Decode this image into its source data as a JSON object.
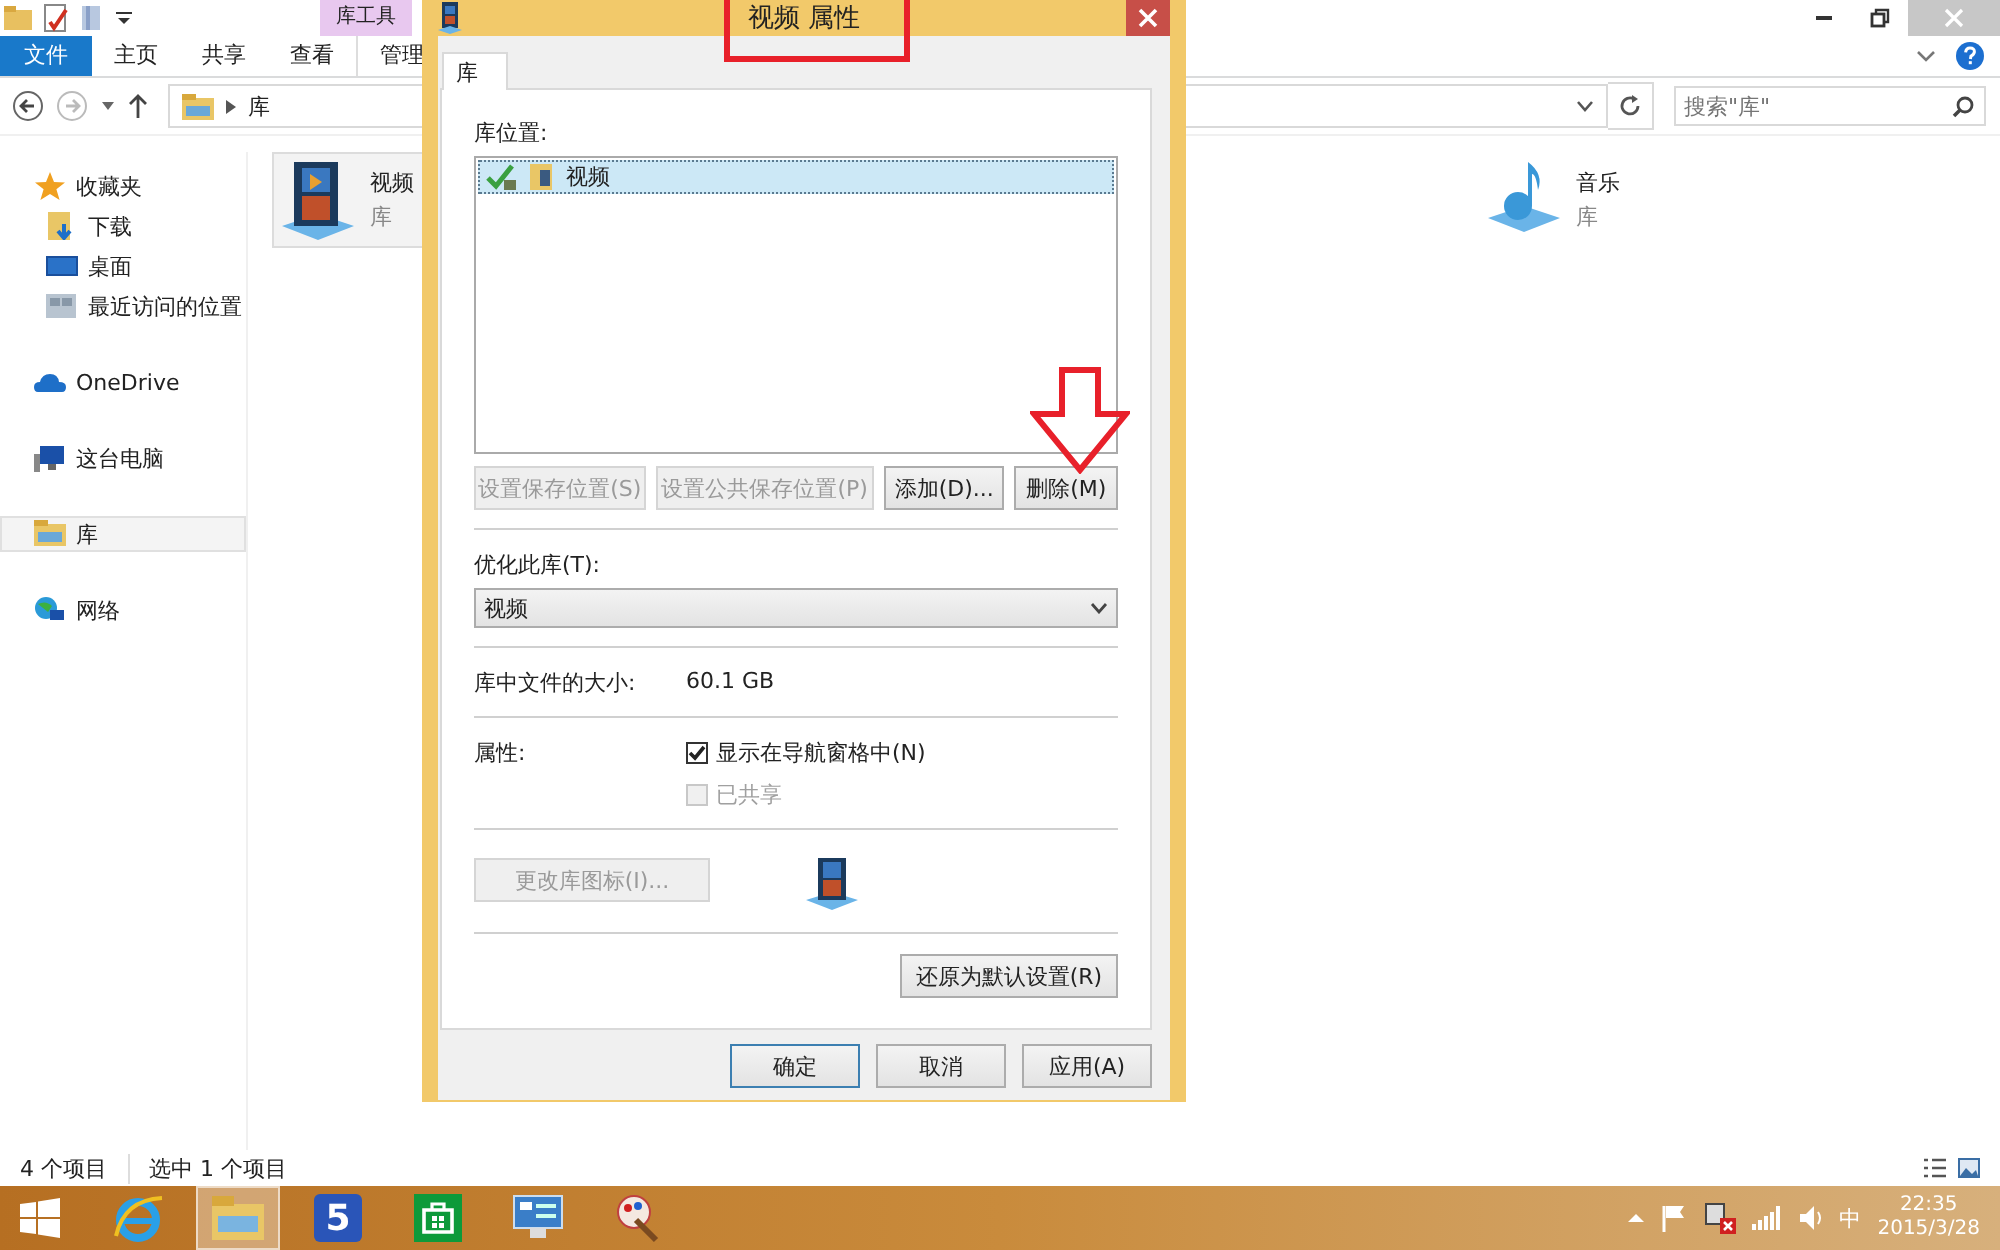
{
  "explorer": {
    "context_tab_group": "库工具",
    "ribbon_tabs": [
      {
        "label": "文件",
        "kind": "file"
      },
      {
        "label": "主页",
        "kind": "tab"
      },
      {
        "label": "共享",
        "kind": "tab"
      },
      {
        "label": "查看",
        "kind": "tab"
      },
      {
        "label": "管理",
        "kind": "context"
      }
    ],
    "address": {
      "path": "库"
    },
    "search": {
      "placeholder": "搜索\"库\""
    },
    "nav_items": [
      {
        "label": "收藏夹",
        "kind": "star",
        "selected": false,
        "children": [
          {
            "label": "下载",
            "kind": "download",
            "selected": false
          },
          {
            "label": "桌面",
            "kind": "desktop",
            "selected": false
          },
          {
            "label": "最近访问的位置",
            "kind": "recent",
            "selected": false
          }
        ]
      },
      {
        "label": "OneDrive",
        "kind": "cloud",
        "selected": false
      },
      {
        "label": "这台电脑",
        "kind": "computer",
        "selected": false
      },
      {
        "label": "库",
        "kind": "library",
        "selected": true
      },
      {
        "label": "网络",
        "kind": "network",
        "selected": false
      }
    ],
    "libraries": [
      {
        "name": "视频",
        "type": "库",
        "kind": "video",
        "selected": true
      },
      {
        "name": "音乐",
        "type": "库",
        "kind": "music",
        "selected": false
      }
    ],
    "status": {
      "count": "4 个项目",
      "selection": "选中 1 个项目"
    }
  },
  "dialog": {
    "title": "视频 属性",
    "tabs": [
      {
        "label": "库",
        "selected": true
      }
    ],
    "locations_label": "库位置:",
    "locations": [
      {
        "name": "视频",
        "selected": true
      }
    ],
    "location_buttons": [
      {
        "label": "设置保存位置(S)",
        "disabled": true
      },
      {
        "label": "设置公共保存位置(P)",
        "disabled": true
      },
      {
        "label": "添加(D)...",
        "disabled": false
      },
      {
        "label": "删除(M)",
        "disabled": false
      }
    ],
    "optimize_label": "优化此库(T):",
    "optimize_value": "视频",
    "size_label": "库中文件的大小:",
    "size_value": "60.1 GB",
    "attributes_label": "属性:",
    "options": [
      {
        "label": "显示在导航窗格中(N)",
        "checked": true,
        "disabled": false
      },
      {
        "label": "已共享",
        "checked": false,
        "disabled": true
      }
    ],
    "change_icon_button": {
      "label": "更改库图标(I)...",
      "disabled": true
    },
    "restore_button": {
      "label": "还原为默认设置(R)",
      "disabled": false
    },
    "footer_buttons": [
      {
        "label": "确定",
        "default": true
      },
      {
        "label": "取消",
        "default": false
      },
      {
        "label": "应用(A)",
        "default": false
      }
    ]
  },
  "annotations": {
    "title_highlight": true,
    "arrow": true
  },
  "taskbar": {
    "apps": [
      {
        "kind": "ie",
        "active": false
      },
      {
        "kind": "explorer",
        "active": true
      },
      {
        "kind": "number",
        "label": "5",
        "active": false
      },
      {
        "kind": "store",
        "active": false
      },
      {
        "kind": "remote",
        "active": false
      },
      {
        "kind": "paint",
        "active": false
      }
    ],
    "ime": "中",
    "time": "22:35",
    "date": "2015/3/28"
  }
}
